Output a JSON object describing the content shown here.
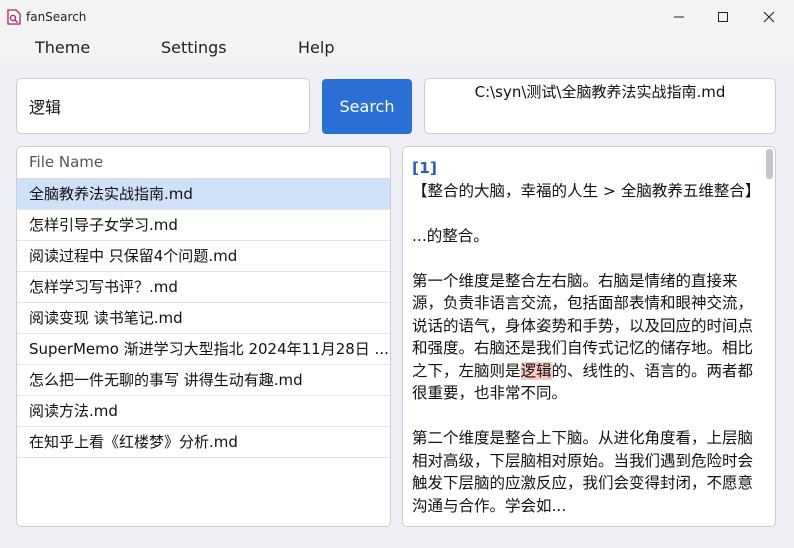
{
  "window": {
    "title": "fanSearch"
  },
  "menu": {
    "theme": "Theme",
    "settings": "Settings",
    "help": "Help"
  },
  "search": {
    "query": "逻辑",
    "button_label": "Search"
  },
  "path_display": "C:\\syn\\测试\\全脑教养法实战指南.md",
  "file_list": {
    "header": "File Name",
    "items": [
      "全脑教养法实战指南.md",
      "怎样引导子女学习.md",
      "阅读过程中 只保留4个问题.md",
      "怎样学习写书评？.md",
      "阅读变现 读书笔记.md",
      "SuperMemo 渐进学习大型指北 2024年11月28日 ...",
      "怎么把一件无聊的事写 讲得生动有趣.md",
      "阅读方法.md",
      "在知乎上看《红楼梦》分析.md"
    ]
  },
  "content": {
    "ref_tag": "[1]",
    "heading": "【整合的大脑，幸福的人生 > 全脑教养五维整合】",
    "intro": "...的整合。",
    "para1_before": "第一个维度是整合左右脑。右脑是情绪的直接来源，负责非语言交流，包括面部表情和眼神交流，说话的语气，身体姿势和手势，以及回应的时间点和强度。右脑还是我们自传式记忆的储存地。相比之下，左脑则是",
    "para1_highlight": "逻辑",
    "para1_after": "的、线性的、语言的。两者都很重要，也非常不同。",
    "para2": "第二个维度是整合上下脑。从进化角度看，上层脑相对高级，下层脑相对原始。当我们遇到危险时会触发下层脑的应激反应，我们会变得封闭，不愿意沟通与合作。学会如..."
  }
}
